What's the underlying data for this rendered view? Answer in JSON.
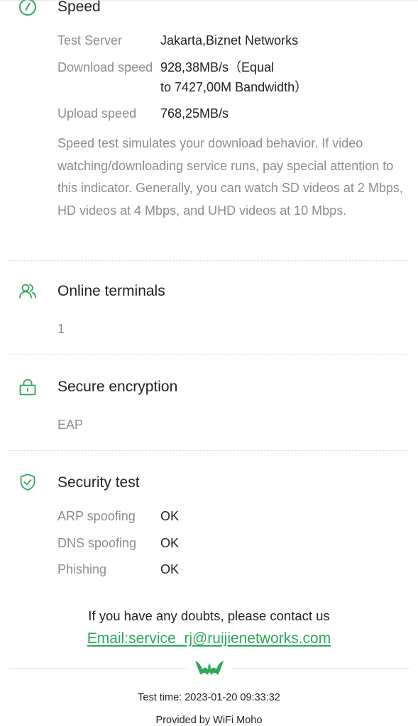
{
  "speed": {
    "title": "Speed",
    "icon": "speedometer-icon",
    "rows": [
      {
        "label": "Test Server",
        "value": "Jakarta,Biznet Networks"
      },
      {
        "label": "Download speed",
        "value_line1": "928,38MB/s（Equal",
        "value_line2": "to 7427,00M Bandwidth）"
      },
      {
        "label": "Upload speed",
        "value": "768,25MB/s"
      }
    ],
    "description": "Speed test simulates your download behavior. If video watching/downloading service runs, pay special attention to this indicator. Generally, you can watch SD videos at 2 Mbps, HD videos at 4 Mbps, and UHD videos at 10 Mbps."
  },
  "online_terminals": {
    "title": "Online terminals",
    "icon": "users-icon",
    "value": "1"
  },
  "secure_encryption": {
    "title": "Secure encryption",
    "icon": "lock-icon",
    "value": "EAP"
  },
  "security_test": {
    "title": "Security test",
    "icon": "shield-check-icon",
    "rows": [
      {
        "label": "ARP spoofing",
        "value": "OK"
      },
      {
        "label": "DNS spoofing",
        "value": "OK"
      },
      {
        "label": "Phishing",
        "value": "OK"
      }
    ]
  },
  "footer": {
    "doubts_text": "If you have any doubts, please contact us",
    "email_text": "Email:service_rj@ruijienetworks.com",
    "logo_icon": "bat-logo-icon",
    "test_time": "Test time: 2023-01-20 09:33:32",
    "provided_by": "Provided by WiFi Moho"
  },
  "colors": {
    "accent": "#2aaa57",
    "label": "#8c8c8c",
    "text": "#222222"
  }
}
